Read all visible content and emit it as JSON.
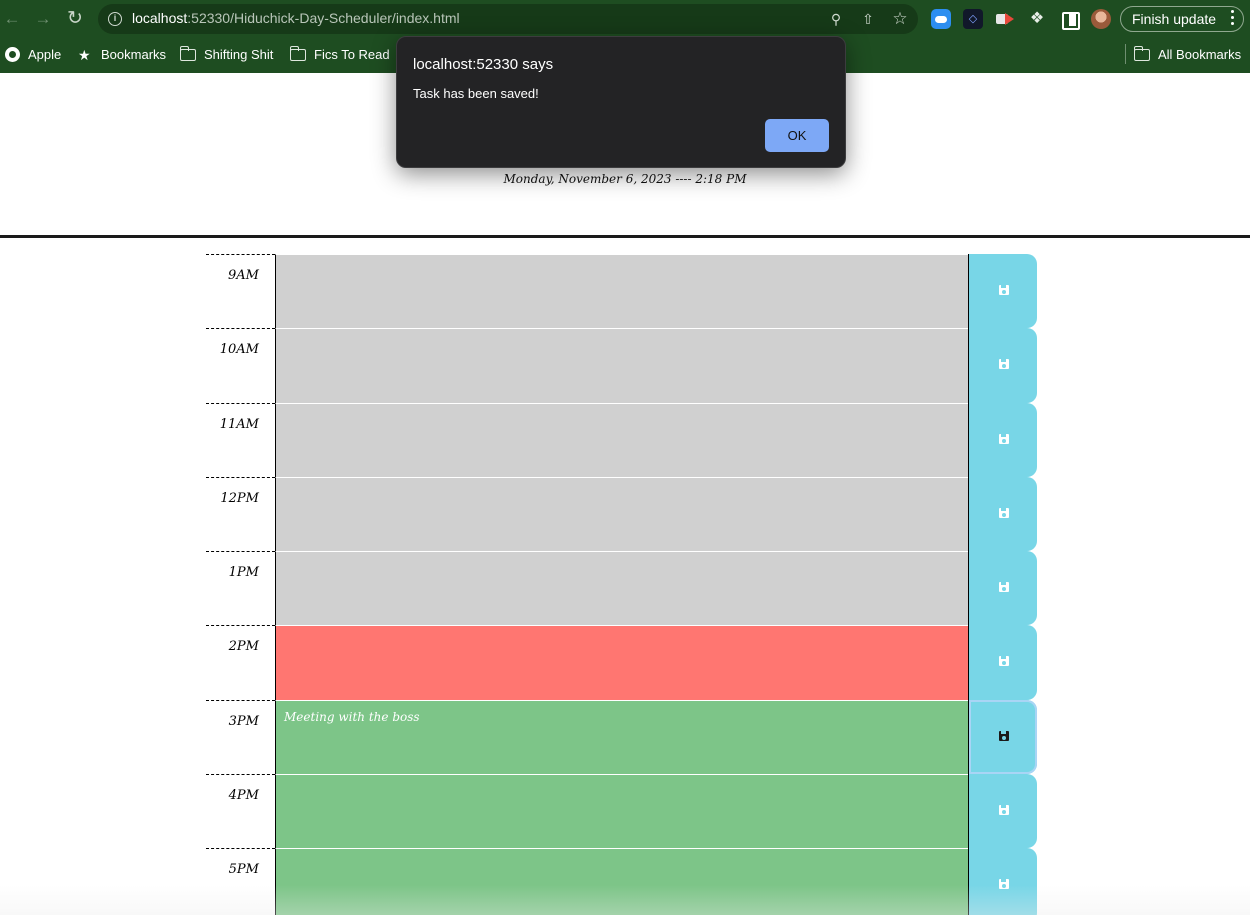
{
  "browser": {
    "url_host": "localhost",
    "url_path": ":52330/Hiduchick-Day-Scheduler/index.html",
    "finish_update_label": "Finish update",
    "icons": [
      "back-icon",
      "forward-icon",
      "reload-icon",
      "info-icon",
      "zoom-icon",
      "share-icon",
      "star-icon",
      "icloud-extension-icon",
      "dark-extension-icon",
      "recorder-extension-icon",
      "extensions-puzzle-icon",
      "side-panel-icon",
      "profile-avatar",
      "menu-kebab-icon"
    ]
  },
  "bookmarks": {
    "items": [
      {
        "label": "Apple",
        "icon": "apple-icon"
      },
      {
        "label": "Bookmarks",
        "icon": "star-icon"
      },
      {
        "label": "Shifting Shit",
        "icon": "folder-icon"
      },
      {
        "label": "Fics To Read",
        "icon": "folder-icon"
      }
    ],
    "all_bookmarks": "All Bookmarks"
  },
  "alert": {
    "title": "localhost:52330 says",
    "message": "Task has been saved!",
    "ok_label": "OK"
  },
  "page": {
    "current_day": "Monday, November 6, 2023 ---- 2:18 PM"
  },
  "schedule": [
    {
      "hour": "9AM",
      "text": "",
      "state": "past"
    },
    {
      "hour": "10AM",
      "text": "",
      "state": "past"
    },
    {
      "hour": "11AM",
      "text": "",
      "state": "past"
    },
    {
      "hour": "12PM",
      "text": "",
      "state": "past"
    },
    {
      "hour": "1PM",
      "text": "",
      "state": "past"
    },
    {
      "hour": "2PM",
      "text": "",
      "state": "present"
    },
    {
      "hour": "3PM",
      "text": "Meeting with the boss",
      "state": "future"
    },
    {
      "hour": "4PM",
      "text": "",
      "state": "future"
    },
    {
      "hour": "5PM",
      "text": "",
      "state": "future"
    }
  ],
  "colors": {
    "past": "#d0d0d0",
    "present": "#ff7671",
    "future": "#7dc588",
    "save_button": "#78d6e7",
    "browser_theme": "#1e4d21"
  }
}
